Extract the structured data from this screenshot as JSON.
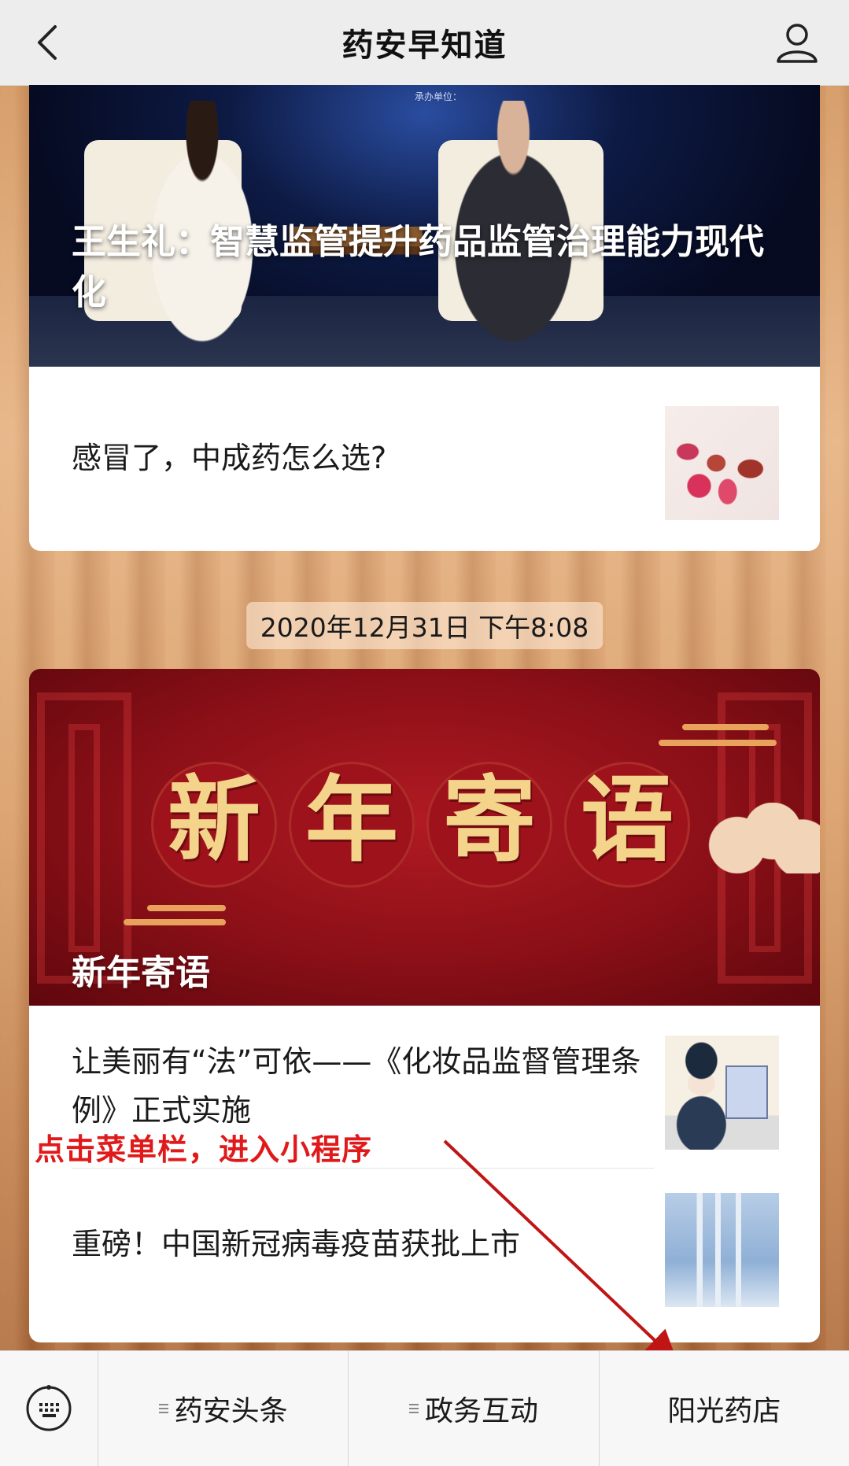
{
  "header": {
    "title": "药安早知道"
  },
  "feed": {
    "article_group_1": {
      "hero_caption": "王生礼：智慧监管提升药品监管治理能力现代化",
      "hero_banner_text": "承办单位：",
      "items": [
        {
          "title": "感冒了，中成药怎么选?"
        }
      ]
    },
    "timestamp": "2020年12月31日 下午8:08",
    "article_group_2": {
      "hero_chars": [
        "新",
        "年",
        "寄",
        "语"
      ],
      "hero_caption": "新年寄语",
      "items": [
        {
          "title": "让美丽有“法”可依——《化妆品监督管理条例》正式实施"
        },
        {
          "title": "重磅！中国新冠病毒疫苗获批上市"
        }
      ]
    }
  },
  "annotation": {
    "text": "点击菜单栏，进入小程序",
    "color": "#e01a1a"
  },
  "bottom_menu": {
    "items": [
      {
        "label": "药安头条",
        "has_submenu": true
      },
      {
        "label": "政务互动",
        "has_submenu": true
      },
      {
        "label": "阳光药店",
        "has_submenu": false
      }
    ]
  },
  "icons": {
    "back": "chevron-left-icon",
    "profile": "user-profile-icon",
    "keyboard": "keyboard-icon",
    "submenu": "menu-lines-icon"
  },
  "colors": {
    "topbar_bg": "#ededed",
    "card_bg": "#ffffff",
    "annotation_red": "#e01a1a",
    "hero_red": "#b11a22",
    "hero_gold": "#f3d48a"
  }
}
